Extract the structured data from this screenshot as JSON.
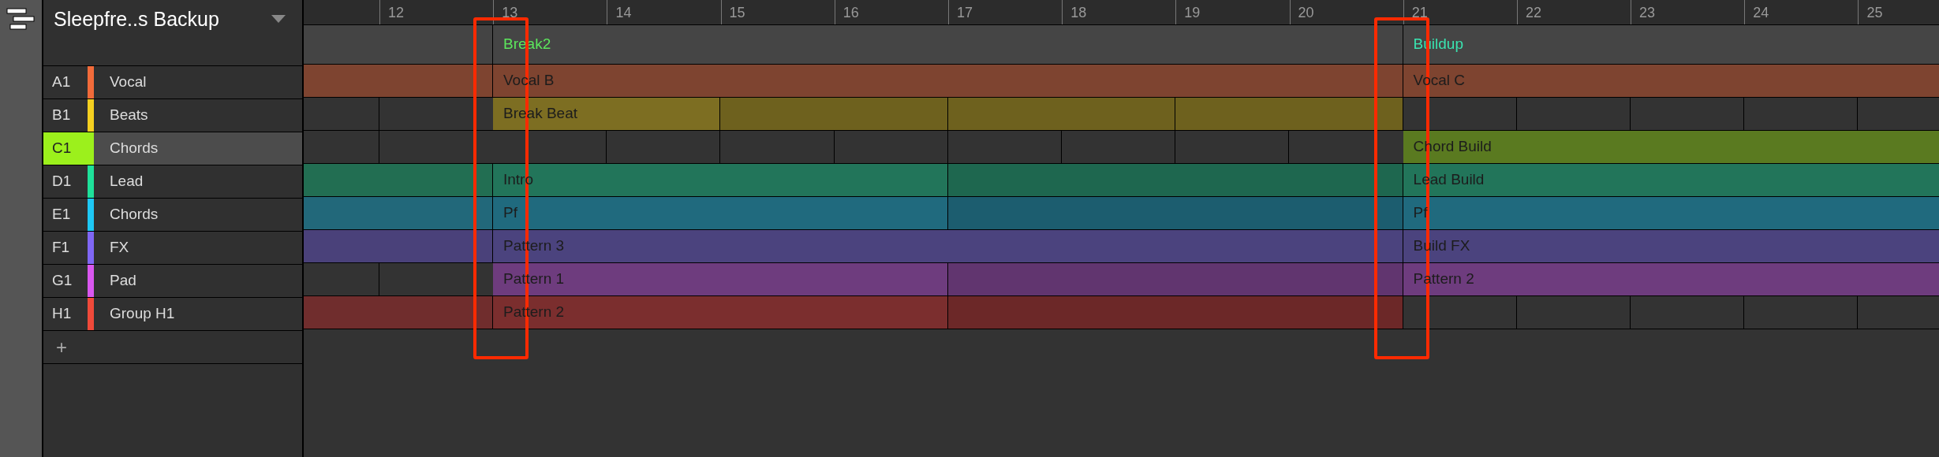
{
  "project": {
    "title": "Sleepfre..s Backup"
  },
  "ruler": [
    "12",
    "13",
    "14",
    "15",
    "16",
    "17",
    "18",
    "19",
    "20",
    "21",
    "22",
    "23",
    "24",
    "25"
  ],
  "scenes": [
    {
      "name": "Break2",
      "color": "#5ce65c"
    },
    {
      "name": "Buildup",
      "color": "#3ae3b0"
    }
  ],
  "tracks": [
    {
      "id": "A1",
      "name": "Vocal",
      "color": "#f26b3a",
      "selected": false,
      "clips": [
        {
          "kind": "clip",
          "color": "#7e4430"
        },
        {
          "kind": "clip",
          "label": "Vocal B",
          "color": "#7e4430"
        },
        {
          "kind": "clip",
          "label": "Vocal C",
          "color": "#7e4430"
        }
      ]
    },
    {
      "id": "B1",
      "name": "Beats",
      "color": "#f5d020",
      "selected": false,
      "clips": [
        {
          "kind": "empty"
        },
        {
          "kind": "clip",
          "label": "Break Beat",
          "color": "#7d6e22"
        },
        {
          "kind": "empty"
        }
      ]
    },
    {
      "id": "C1",
      "name": "Chords",
      "color": "#9cf01c",
      "selected": true,
      "clips": [
        {
          "kind": "empty"
        },
        {
          "kind": "empty"
        },
        {
          "kind": "clip",
          "label": "Chord Build",
          "color": "#5a7a20"
        }
      ]
    },
    {
      "id": "D1",
      "name": "Lead",
      "color": "#1ee19a",
      "selected": false,
      "clips": [
        {
          "kind": "clip",
          "color": "#226e52"
        },
        {
          "kind": "clip",
          "label": "Intro",
          "color": "#22755a"
        },
        {
          "kind": "clip",
          "label": "Lead Build",
          "color": "#22755a"
        }
      ]
    },
    {
      "id": "E1",
      "name": "Chords",
      "color": "#1ec8f5",
      "selected": false,
      "clips": [
        {
          "kind": "clip",
          "color": "#22687a"
        },
        {
          "kind": "clip",
          "label": "Pf",
          "color": "#206a7e"
        },
        {
          "kind": "clip",
          "label": "Pf",
          "color": "#206a7e"
        }
      ]
    },
    {
      "id": "F1",
      "name": "FX",
      "color": "#8067f5",
      "selected": false,
      "clips": [
        {
          "kind": "clip",
          "color": "#4a417a"
        },
        {
          "kind": "clip",
          "label": "Pattern 3",
          "color": "#4b437e"
        },
        {
          "kind": "clip",
          "label": "Build FX",
          "color": "#4b437e"
        }
      ]
    },
    {
      "id": "G1",
      "name": "Pad",
      "color": "#d957f0",
      "selected": false,
      "clips": [
        {
          "kind": "empty"
        },
        {
          "kind": "clip",
          "label": "Pattern 1",
          "color": "#6e3c7e"
        },
        {
          "kind": "clip",
          "label": "Pattern 2",
          "color": "#6e3c7e"
        }
      ]
    },
    {
      "id": "H1",
      "name": "Group H1",
      "color": "#f04a3a",
      "selected": false,
      "clips": [
        {
          "kind": "clip",
          "color": "#702d2d"
        },
        {
          "kind": "clip",
          "label": "Pattern 2",
          "color": "#7b2e2e"
        },
        {
          "kind": "empty"
        }
      ]
    }
  ],
  "add_button": "+"
}
